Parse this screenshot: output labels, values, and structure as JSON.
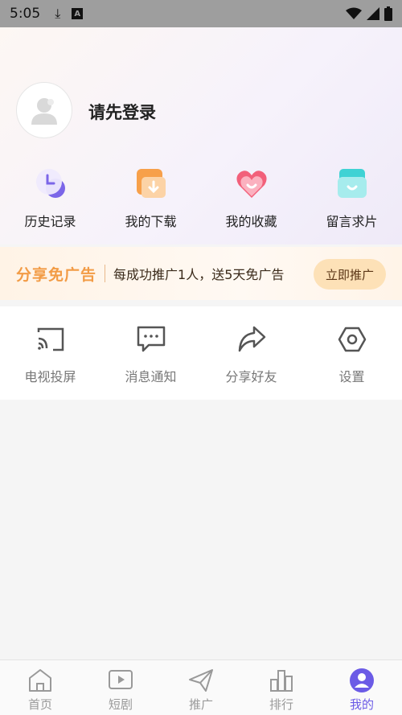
{
  "status_bar": {
    "time": "5:05"
  },
  "profile": {
    "login_prompt": "请先登录"
  },
  "quick_actions": [
    {
      "label": "历史记录",
      "icon": "history-icon"
    },
    {
      "label": "我的下载",
      "icon": "download-icon"
    },
    {
      "label": "我的收藏",
      "icon": "favorite-icon"
    },
    {
      "label": "留言求片",
      "icon": "message-request-icon"
    }
  ],
  "promo": {
    "title": "分享免广告",
    "description": "每成功推广1人，送5天免广告",
    "button_label": "立即推广"
  },
  "tools": [
    {
      "label": "电视投屏",
      "icon": "cast-icon"
    },
    {
      "label": "消息通知",
      "icon": "chat-icon"
    },
    {
      "label": "分享好友",
      "icon": "share-icon"
    },
    {
      "label": "设置",
      "icon": "settings-icon"
    }
  ],
  "bottom_nav": [
    {
      "label": "首页",
      "icon": "home-icon"
    },
    {
      "label": "短剧",
      "icon": "video-icon"
    },
    {
      "label": "推广",
      "icon": "send-icon"
    },
    {
      "label": "排行",
      "icon": "ranking-icon"
    },
    {
      "label": "我的",
      "icon": "profile-icon",
      "active": true
    }
  ],
  "colors": {
    "accent": "#6b5be6",
    "promo_title": "#f29b45",
    "promo_button": "#fde1b7"
  }
}
